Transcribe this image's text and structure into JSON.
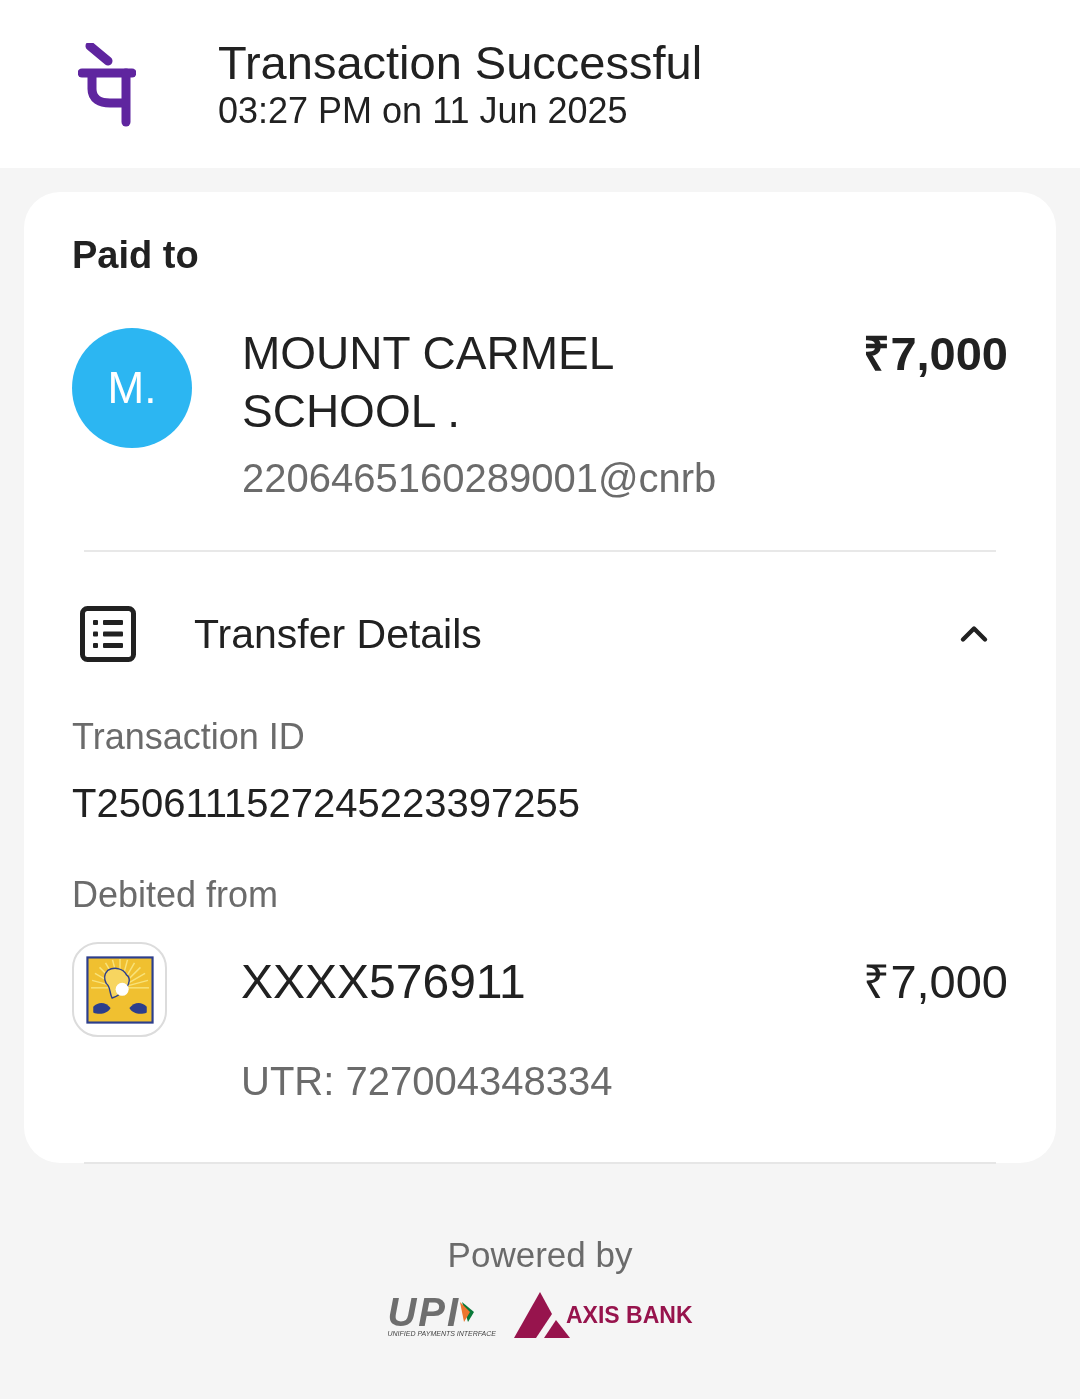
{
  "header": {
    "title": "Transaction Successful",
    "subtitle": "03:27 PM on 11 Jun 2025"
  },
  "paid_to": {
    "heading": "Paid to",
    "avatar": "M.",
    "name": "MOUNT CARMEL SCHOOL .",
    "upi_id": "2206465160289001@cnrb",
    "amount": "₹7,000"
  },
  "transfer_details": {
    "title": "Transfer Details",
    "expanded": true,
    "transaction_id_label": "Transaction ID",
    "transaction_id": "T2506111527245223397255",
    "debited_from_label": "Debited from",
    "account": "XXXX576911",
    "amount": "₹7,000",
    "utr": "UTR: 727004348334"
  },
  "footer": {
    "powered_by": "Powered by",
    "upi_logo": "UPI",
    "upi_tagline": "UNIFIED PAYMENTS INTERFACE",
    "bank": "AXIS BANK"
  }
}
